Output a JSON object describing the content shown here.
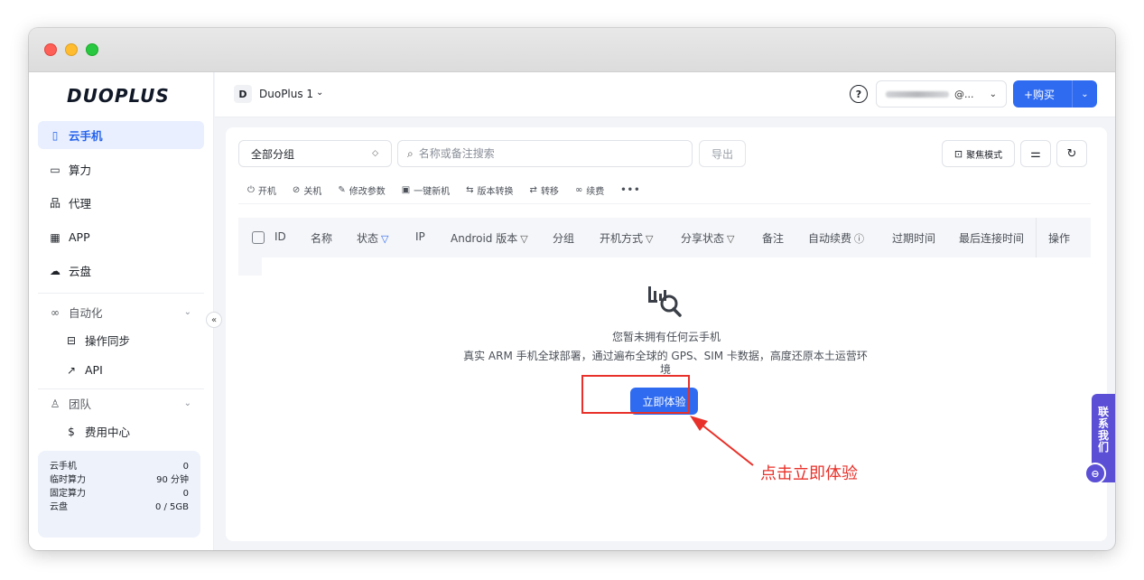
{
  "sidebar": {
    "logo": "DUOPLUS",
    "items": [
      {
        "label": "云手机",
        "icon": "phone-icon"
      },
      {
        "label": "算力",
        "icon": "monitor-icon"
      },
      {
        "label": "代理",
        "icon": "network-icon"
      },
      {
        "label": "APP",
        "icon": "grid-icon"
      },
      {
        "label": "云盘",
        "icon": "cloud-icon"
      }
    ],
    "automation": {
      "label": "自动化",
      "icon": "infinity-icon",
      "children": [
        {
          "label": "操作同步",
          "icon": "sync-icon"
        },
        {
          "label": "API",
          "icon": "api-icon"
        }
      ]
    },
    "team": {
      "label": "团队",
      "icon": "users-icon",
      "children": [
        {
          "label": "费用中心",
          "icon": "dollar-icon"
        }
      ]
    },
    "stats": [
      {
        "label": "云手机",
        "value": "0"
      },
      {
        "label": "临时算力",
        "value": "90 分钟"
      },
      {
        "label": "固定算力",
        "value": "0"
      },
      {
        "label": "云盘",
        "value": "0 / 5GB"
      }
    ]
  },
  "topbar": {
    "workspace_badge": "D",
    "workspace_name": "DuoPlus 1",
    "account_suffix": "@...",
    "buy_label": "+购买"
  },
  "toolbar": {
    "group_select": "全部分组",
    "search_placeholder": "名称或备注搜索",
    "export_label": "导出",
    "focus_label": "聚焦模式"
  },
  "actions": [
    {
      "label": "开机",
      "icon": "power-icon"
    },
    {
      "label": "关机",
      "icon": "power-off-icon"
    },
    {
      "label": "修改参数",
      "icon": "edit-icon"
    },
    {
      "label": "一键新机",
      "icon": "new-device-icon"
    },
    {
      "label": "版本转换",
      "icon": "convert-icon"
    },
    {
      "label": "转移",
      "icon": "transfer-icon"
    },
    {
      "label": "续费",
      "icon": "renew-icon"
    }
  ],
  "table": {
    "columns": [
      "ID",
      "名称",
      "状态",
      "IP",
      "Android 版本",
      "分组",
      "开机方式",
      "分享状态",
      "备注",
      "自动续费",
      "过期时间",
      "最后连接时间",
      "操作"
    ]
  },
  "empty": {
    "title": "您暂未拥有任何云手机",
    "description": "真实 ARM 手机全球部署，通过遍布全球的 GPS、SIM 卡数据，高度还原本土运营环境",
    "button": "立即体验"
  },
  "annotation": {
    "text": "点击立即体验",
    "color": "#e8312a"
  },
  "contact": {
    "label": "联系我们"
  },
  "colors": {
    "accent": "#2f6bf0",
    "contact": "#5b4fd6"
  }
}
